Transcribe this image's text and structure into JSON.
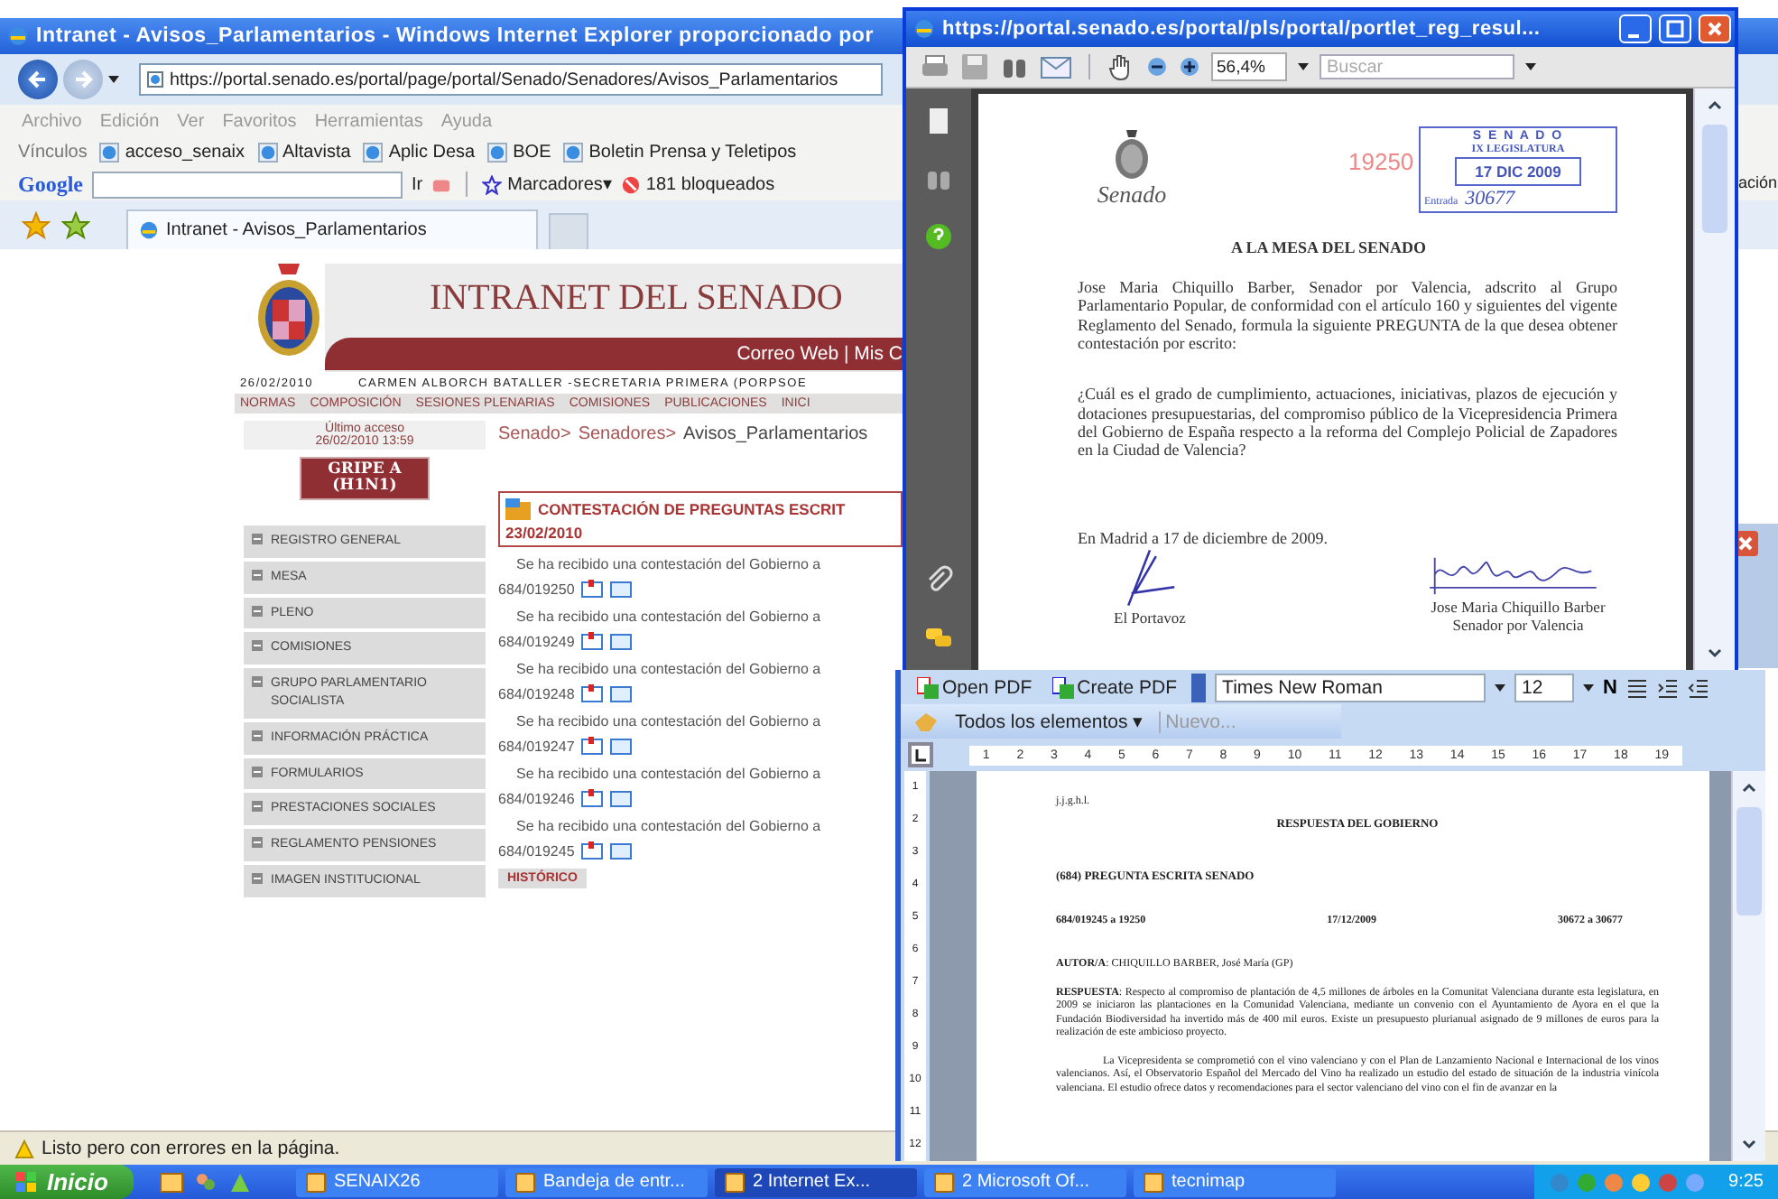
{
  "browser": {
    "title": "Intranet - Avisos_Parlamentarios - Windows Internet Explorer proporcionado por",
    "address": "https://portal.senado.es/portal/page/portal/Senado/Senadores/Avisos_Parlamentarios",
    "menu": [
      "Archivo",
      "Edición",
      "Ver",
      "Favoritos",
      "Herramientas",
      "Ayuda"
    ],
    "links_label": "Vínculos",
    "links": [
      "acceso_senaix",
      "Altavista",
      "Aplic Desa",
      "BOE",
      "Boletin Prensa y Teletipos"
    ],
    "google": {
      "logo": "Google",
      "go": "Ir",
      "bookmarks": "Marcadores▾",
      "blocked": "181 bloqueados"
    },
    "right_fragment": "ación",
    "tabs": [
      {
        "label": "Intranet - Avisos_Parlamentarios",
        "selected": true
      }
    ],
    "status": "Listo pero con errores en la página."
  },
  "intranet": {
    "title": "INTRANET DEL SENADO",
    "top_links": "Correo Web | Mis C",
    "date": "26/02/2010",
    "user": "CARMEN ALBORCH BATALLER -SECRETARIA PRIMERA (PORPSOE",
    "nav": [
      "NORMAS",
      "COMPOSICIÓN",
      "SESIONES PLENARIAS",
      "COMISIONES",
      "PUBLICACIONES",
      "INICI"
    ],
    "last_access_label": "Último acceso",
    "last_access": "26/02/2010 13:59",
    "flu_button": [
      "GRIPE A",
      "(H1N1)"
    ],
    "sidebar": [
      "REGISTRO GENERAL",
      "MESA",
      "PLENO",
      "COMISIONES",
      "GRUPO PARLAMENTARIO SOCIALISTA",
      "INFORMACIÓN PRÁCTICA",
      "FORMULARIOS",
      "PRESTACIONES SOCIALES",
      "REGLAMENTO PENSIONES",
      "IMAGEN INSTITUCIONAL"
    ],
    "breadcrumb": [
      "Senado>",
      "Senadores>",
      "Avisos_Parlamentarios"
    ],
    "section_title": "CONTESTACIÓN DE PREGUNTAS ESCRIT",
    "section_date": "23/02/2010",
    "notices": [
      {
        "text": "Se ha recibido una contestación del Gobierno a",
        "number": "684/019250"
      },
      {
        "text": "Se ha recibido una contestación del Gobierno a",
        "number": "684/019249"
      },
      {
        "text": "Se ha recibido una contestación del Gobierno a",
        "number": "684/019248"
      },
      {
        "text": "Se ha recibido una contestación del Gobierno a",
        "number": "684/019247"
      },
      {
        "text": "Se ha recibido una contestación del Gobierno a",
        "number": "684/019246"
      },
      {
        "text": "Se ha recibido una contestación del Gobierno a",
        "number": "684/019245"
      }
    ],
    "history_button": "HISTÓRICO"
  },
  "pdf_window": {
    "title": "https://portal.senado.es/portal/pls/portal/portlet_reg_resul...",
    "zoom": "56,4%",
    "search_placeholder": "Buscar",
    "doc": {
      "emblem_caption": "Senado",
      "number": "19250",
      "stamp": {
        "name": "S E N A D O",
        "legislature": "IX LEGISLATURA",
        "date": "17 DIC 2009",
        "entry_label": "Entrada",
        "entry": "30677"
      },
      "addressee": "A LA MESA DEL SENADO",
      "paragraphs": [
        "Jose Maria Chiquillo Barber, Senador por Valencia, adscrito al Grupo Parlamentario Popular, de conformidad con el artículo 160 y siguientes del vigente Reglamento del Senado, formula la siguiente PREGUNTA de la que desea obtener contestación por escrito:",
        "¿Cuál es el grado de cumplimiento, actuaciones, iniciativas, plazos de ejecución y dotaciones presupuestarias, del compromiso público de la Vicepresidencia Primera del Gobierno de España respecto a la reforma del Complejo Policial de Zapadores en la Ciudad de Valencia?"
      ],
      "place_date": "En Madrid a 17 de diciembre de 2009.",
      "signer_left": "El Portavoz",
      "signer_right": [
        "Jose Maria Chiquillo Barber",
        "Senador por Valencia"
      ]
    }
  },
  "word_window": {
    "toolbar": {
      "open_pdf": "Open PDF",
      "create_pdf": "Create PDF",
      "font": "Times New Roman",
      "size": "12",
      "bold": "N",
      "elements": "Todos los elementos ▾",
      "new": {
        "label": "Nuevo...",
        "disabled": true
      }
    },
    "ruler": [
      "1",
      "2",
      "3",
      "4",
      "5",
      "6",
      "7",
      "8",
      "9",
      "10",
      "11",
      "12",
      "13",
      "14",
      "15",
      "16",
      "17",
      "18",
      "19"
    ],
    "vruler": [
      "1",
      "2",
      "3",
      "4",
      "5",
      "6",
      "7",
      "8",
      "9",
      "10",
      "11",
      "12"
    ],
    "doc": {
      "initials": "j.j.g.h.l.",
      "heading": "RESPUESTA DEL GOBIERNO",
      "question": "(684) PREGUNTA ESCRITA SENADO",
      "ref": "684/019245 a 19250",
      "date": "17/12/2009",
      "entries": "30672 a 30677",
      "paragraphs": [
        "**AUTOR/A**: CHIQUILLO BARBER, José María (GP)",
        "**RESPUESTA**: Respecto al compromiso de plantación de 4,5 millones de árboles en la Comunitat Valenciana durante esta legislatura, en 2009 se iniciaron las plantaciones en la Comunidad Valenciana, mediante un convenio con el Ayuntamiento de Ayora en el que la Fundación Biodiversidad ha invertido más de 400 mil euros. Existe un presupuesto plurianual asignado de 9 millones de euros para la realización de este ambicioso proyecto.",
        "La Vicepresidenta se comprometió con el vino valenciano y con el Plan de Lanzamiento Nacional e Internacional de los vinos valencianos. Así, el Observatorio Español del Mercado del Vino ha realizado un estudio del estado de situación de la industria vinícola valenciana. El estudio ofrece datos y recomendaciones para el sector valenciano del vino con el fin de avanzar en la"
      ]
    }
  },
  "taskbar": {
    "start": "Inicio",
    "tasks": [
      {
        "label": "SENAIX26",
        "selected": false
      },
      {
        "label": "Bandeja de entr...",
        "selected": false
      },
      {
        "label": "2 Internet Ex...",
        "selected": true
      },
      {
        "label": "2 Microsoft Of...",
        "selected": false
      },
      {
        "label": "tecnimap",
        "selected": false
      }
    ],
    "clock": "9:25"
  }
}
